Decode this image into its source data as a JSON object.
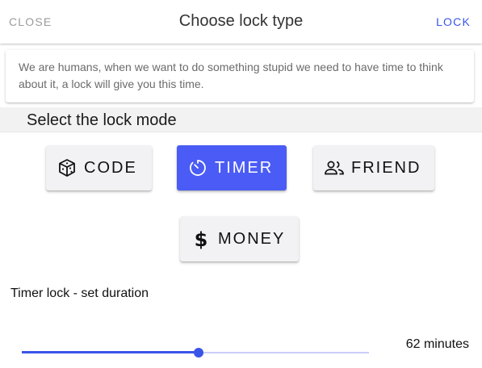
{
  "appbar": {
    "close_label": "CLOSE",
    "title": "Choose lock type",
    "lock_label": "LOCK"
  },
  "info": {
    "text": "We are humans, when we want to do something stupid we need to have time to think about it, a lock will give you this time."
  },
  "section": {
    "title": "Select the lock mode"
  },
  "modes": [
    {
      "label": "CODE",
      "icon": "dice-icon",
      "active": false
    },
    {
      "label": "TIMER",
      "icon": "timer-icon",
      "active": true
    },
    {
      "label": "FRIEND",
      "icon": "people-icon",
      "active": false
    },
    {
      "label": "MONEY",
      "icon": "dollar-icon",
      "active": false
    }
  ],
  "timer": {
    "label": "Timer lock - set duration",
    "value_text": "62 minutes",
    "slider_fraction": 0.51
  },
  "colors": {
    "accent": "#3a55e8",
    "active_button": "#4a5cf5",
    "muted_text": "#9b9b9b"
  }
}
